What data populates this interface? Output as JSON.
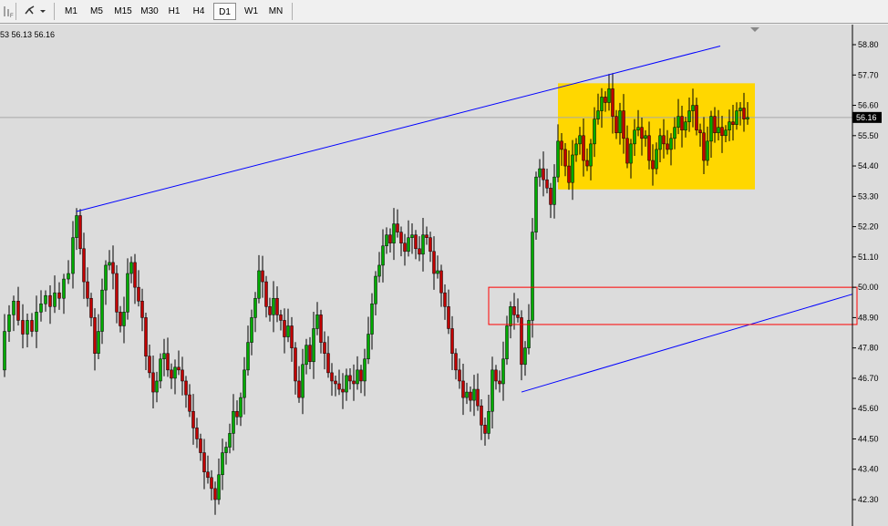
{
  "toolbar": {
    "timeframes": [
      "M1",
      "M5",
      "M15",
      "M30",
      "H1",
      "H4",
      "D1",
      "W1",
      "MN"
    ],
    "active_timeframe": "D1"
  },
  "chart": {
    "ohlc_readout": "53 56.13 56.16",
    "current_price_label": "56.16",
    "background_color": "#dcdcdc",
    "bull_color": "#00aa00",
    "bear_color": "#c00000",
    "highlight_color": "#ffd700",
    "trendline_color": "#0000ff",
    "box_color": "#ff0000"
  },
  "chart_data": {
    "type": "candlestick",
    "y_ticks": [
      "58.80",
      "57.70",
      "56.60",
      "55.50",
      "54.40",
      "53.30",
      "52.20",
      "51.10",
      "50.00",
      "48.90",
      "47.80",
      "46.70",
      "45.60",
      "44.50",
      "43.40",
      "42.30"
    ],
    "ylim": [
      41.6,
      59.2
    ],
    "last_price": 56.16,
    "highlight_zone": {
      "y_low": 53.55,
      "y_high": 57.4
    },
    "resistance_box": {
      "y_low": 48.65,
      "y_high": 50.0
    },
    "grid": false
  }
}
